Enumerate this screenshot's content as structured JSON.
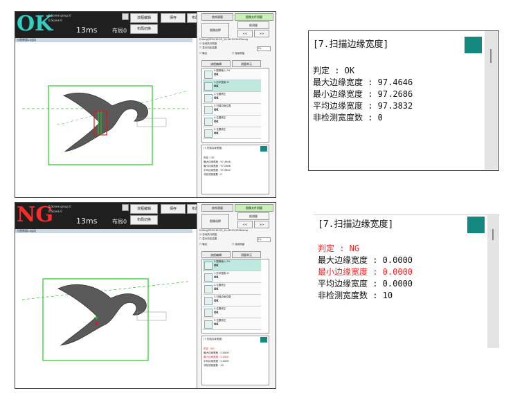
{
  "ok_screen": {
    "status": "OK",
    "status_color": "#2fd0c4",
    "scene_lines": [
      "0.Scene group 0",
      "0.Scene 0"
    ],
    "cycle_time": "13ms",
    "buji": "布局0",
    "toolbar": {
      "flow_edit": "流程编辑",
      "save": "保存",
      "layout_switch": "布局切换",
      "screen_switch": "布局切换"
    },
    "view_label": "与图像窗口连动",
    "right_tabs": [
      "结构测量",
      "图像文件测量"
    ],
    "image_select": "图像选择",
    "prev_image": "前测量",
    "nav_prev": "<<",
    "nav_next": ">>",
    "file_path": "D:/Img/2024-10-23_14-28-29-5503.bmp",
    "chk_auto": "自动执行测量",
    "chk_image": "显示判定结果",
    "opt_output": "输出",
    "opt_continuous": "连续测量",
    "sel_value": "1%",
    "subtabs": [
      "流程编辑",
      "测量单元"
    ],
    "list_items": [
      {
        "title": "0.图像输入 FH",
        "state": "OK"
      },
      {
        "title": "1.形状搜索 III",
        "state": "OK"
      },
      {
        "title": "2.位置修正",
        "state": "OK"
      },
      {
        "title": "3.扫描边缘位置",
        "state": "OK"
      },
      {
        "title": "4.位置修正",
        "state": "OK"
      },
      {
        "title": "5.位置修正",
        "state": "OK"
      }
    ],
    "mini_result": {
      "title": "[7.扫描边缘宽度]",
      "lines": [
        "判定 : OK",
        "最大边缘宽度 : 97.4646",
        "最小边缘宽度 : 97.2686",
        "平均边缘宽度 : 97.3832",
        "非检测宽度数 : 0"
      ]
    }
  },
  "ng_screen": {
    "status": "NG",
    "status_color": "#ff2a2a",
    "scene_lines": [
      "0.Scene group 0",
      "0.Scene 0"
    ],
    "cycle_time": "13ms",
    "buji": "布局0",
    "toolbar": {
      "flow_edit": "流程编辑",
      "save": "保存",
      "layout_switch": "布局切换",
      "screen_switch": "布局切换"
    },
    "view_label": "与图像窗口连动",
    "right_tabs": [
      "结构测量",
      "图像文件测量"
    ],
    "image_select": "图像选择",
    "prev_image": "前测量",
    "nav_prev": "<<",
    "nav_next": ">>",
    "file_path": "D:/Img/2024-10-23_14-28-29-5506.bmp",
    "chk_auto": "自动执行测量",
    "chk_image": "显示判定结果",
    "opt_output": "输出",
    "opt_continuous": "连续测量",
    "sel_value": "1%",
    "subtabs": [
      "流程编辑",
      "测量单元"
    ],
    "list_items": [
      {
        "title": "0.图像输入 FH",
        "state": "OK"
      },
      {
        "title": "1.形状搜索 III",
        "state": "OK"
      },
      {
        "title": "2.位置修正",
        "state": "OK"
      },
      {
        "title": "3.扫描边缘位置",
        "state": "OK"
      },
      {
        "title": "4.位置修正",
        "state": "OK"
      },
      {
        "title": "5.位置修正",
        "state": "OK"
      }
    ],
    "mini_result": {
      "title": "[7.扫描边缘宽度]",
      "lines": [
        "判定 : NG",
        "最大边缘宽度 : 0.0000",
        "最小边缘宽度 : 0.0000",
        "平均边缘宽度 : 0.0000",
        "非检测宽度数 : 10"
      ]
    }
  },
  "ok_result": {
    "title": "[7.扫描边缘宽度]",
    "judge": "判定 : OK",
    "max": "最大边缘宽度 : 97.4646",
    "min": "最小边缘宽度 : 97.2686",
    "avg": "平均边缘宽度 : 97.3832",
    "undetected": "非检测宽度数 : 0"
  },
  "ng_result": {
    "title": "[7.扫描边缘宽度]",
    "judge": "判定 : NG",
    "max": "最大边缘宽度 : 0.0000",
    "min": "最小边缘宽度 : 0.0000",
    "avg": "平均边缘宽度 : 0.0000",
    "undetected": "非检测宽度数 : 10"
  },
  "colors": {
    "teal": "#12887e",
    "ng_red": "#ff2222",
    "ok_cyan": "#2fd0c4",
    "green_box": "#22cc22"
  }
}
